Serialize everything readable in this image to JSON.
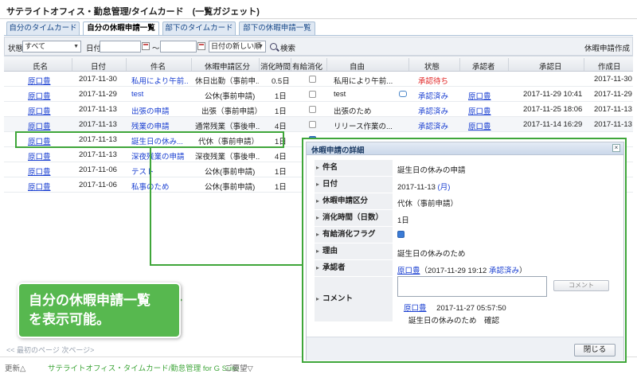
{
  "app": {
    "title": "サテライトオフィス・勤怠管理/タイムカード　(一覧ガジェット)"
  },
  "tabs": [
    {
      "label": "自分のタイムカード",
      "active": false
    },
    {
      "label": "自分の休暇申請一覧",
      "active": true
    },
    {
      "label": "部下のタイムカード",
      "active": false
    },
    {
      "label": "部下の休暇申請一覧",
      "active": false
    }
  ],
  "filter": {
    "status_label": "状態",
    "status_value": "すべて",
    "date_label": "日付",
    "date_from": "",
    "range_sep": "～",
    "date_to": "",
    "sort_value": "日付の新しい順",
    "search_label": "検索",
    "right_title": "休暇申請作成"
  },
  "columns": [
    "氏名",
    "日付",
    "件名",
    "休暇申請区分",
    "消化時間",
    "有給消化",
    "自由",
    "状態",
    "承認者",
    "承認日",
    "作成日"
  ],
  "rows": [
    {
      "name": "原口豊",
      "date": "2017-11-30",
      "subject": "私用により午前...",
      "category": "休日出勤（事前申...",
      "time": "0.5日",
      "paid": false,
      "reason": "私用により午前...",
      "comment": false,
      "status": "承認待ち",
      "status_kind": "pending",
      "approver": "",
      "approved": "",
      "created": "2017-11-30"
    },
    {
      "name": "原口豊",
      "date": "2017-11-29",
      "subject": "test",
      "category": "公休(事前申請)",
      "time": "1日",
      "paid": false,
      "reason": "test",
      "comment": true,
      "status": "承認済み",
      "status_kind": "ok",
      "approver": "原口豊",
      "approved": "2017-11-29 10:41",
      "created": "2017-11-29"
    },
    {
      "name": "原口豊",
      "date": "2017-11-13",
      "subject": "出張の申請",
      "category": "出張（事前申請）",
      "time": "1日",
      "paid": false,
      "reason": "出張のため",
      "comment": false,
      "status": "承認済み",
      "status_kind": "ok",
      "approver": "原口豊",
      "approved": "2017-11-25 18:06",
      "created": "2017-11-13"
    },
    {
      "name": "原口豊",
      "date": "2017-11-13",
      "subject": "残業の申請",
      "category": "通常残業（事後申...",
      "time": "4日",
      "paid": false,
      "reason": "リリース作業の...",
      "comment": false,
      "status": "承認済み",
      "status_kind": "ok",
      "approver": "原口豊",
      "approved": "2017-11-14 16:29",
      "created": "2017-11-13"
    },
    {
      "name": "原口豊",
      "date": "2017-11-13",
      "subject": "誕生日の休み...",
      "category": "代休（事前申請）",
      "time": "1日",
      "paid": true,
      "reason": "",
      "comment": false,
      "status": "",
      "status_kind": "",
      "approver": "",
      "approved": "",
      "created": ""
    },
    {
      "name": "原口豊",
      "date": "2017-11-13",
      "subject": "深夜残業の申請",
      "category": "深夜残業（事後申...",
      "time": "4日",
      "paid": false,
      "reason": "",
      "comment": false,
      "status": "",
      "status_kind": "",
      "approver": "",
      "approved": "",
      "created": ""
    },
    {
      "name": "原口豊",
      "date": "2017-11-06",
      "subject": "テスト",
      "category": "公休(事前申請)",
      "time": "1日",
      "paid": false,
      "reason": "",
      "comment": false,
      "status": "",
      "status_kind": "",
      "approver": "",
      "approved": "",
      "created": ""
    },
    {
      "name": "原口豊",
      "date": "2017-11-06",
      "subject": "私事のため",
      "category": "公休(事前申請)",
      "time": "1日",
      "paid": false,
      "reason": "",
      "comment": false,
      "status": "",
      "status_kind": "",
      "approver": "",
      "approved": "",
      "created": ""
    }
  ],
  "pager": "<< 最初のページ  次ページ>",
  "footer": {
    "update": "更新△",
    "brand": "サテライトオフィス・タイムカード/勤怠管理 for G Suite",
    "feedback": "ご要望▽"
  },
  "callout": {
    "line1": "自分の休暇申請一覧",
    "line2": "を表示可能。"
  },
  "dialog": {
    "title": "休暇申請の詳細",
    "close_x": "×",
    "fields": [
      {
        "label": "件名",
        "value": "誕生日の休みの申請"
      },
      {
        "label": "日付",
        "value": "2017-11-13",
        "suffix": "(月)"
      },
      {
        "label": "休暇申請区分",
        "value": "代休（事前申請）"
      },
      {
        "label": "消化時間（日数）",
        "value": "1日"
      },
      {
        "label": "有給消化フラグ",
        "checked": true
      },
      {
        "label": "理由",
        "value": "誕生日の休みのため"
      },
      {
        "label": "承認者",
        "approver": "原口豊",
        "detail": "（2017-11-29 19:12 ",
        "status": "承認済み",
        "close": "）"
      },
      {
        "label": "コメント"
      }
    ],
    "comment_button": "コメント",
    "comment_entry": {
      "author": "原口豊",
      "time": "2017-11-27 05:57:50",
      "text": "誕生日の休みのため　確認"
    },
    "close_button": "閉じる"
  }
}
